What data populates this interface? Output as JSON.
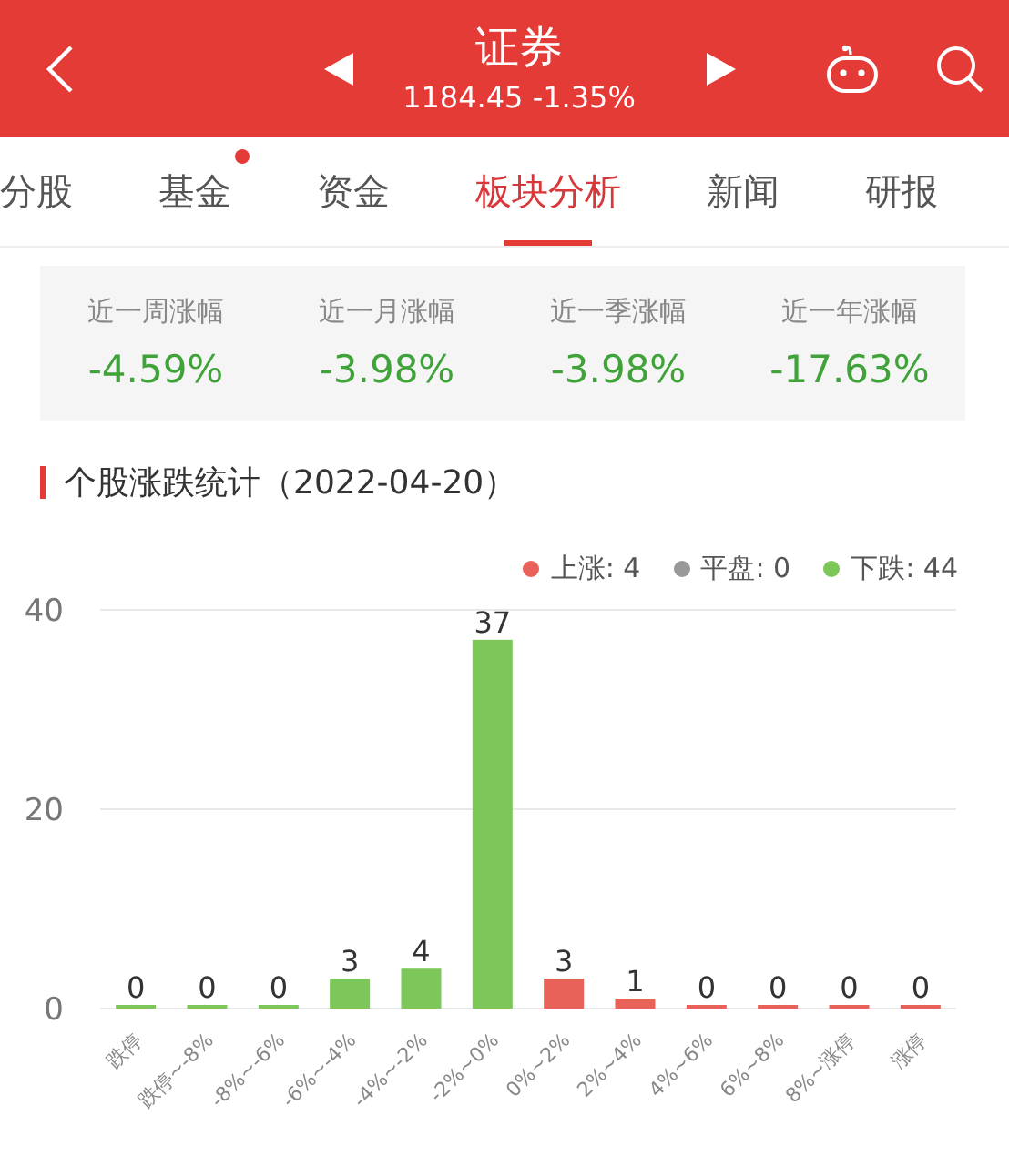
{
  "header": {
    "title": "证券",
    "subtitle": "1184.45 -1.35%"
  },
  "tabs": [
    {
      "label": "分股",
      "selected": false,
      "dot": false
    },
    {
      "label": "基金",
      "selected": false,
      "dot": true
    },
    {
      "label": "资金",
      "selected": false,
      "dot": false
    },
    {
      "label": "板块分析",
      "selected": true,
      "dot": false
    },
    {
      "label": "新闻",
      "selected": false,
      "dot": false
    },
    {
      "label": "研报",
      "selected": false,
      "dot": false
    }
  ],
  "stats": [
    {
      "label": "近一周涨幅",
      "value": "-4.59%"
    },
    {
      "label": "近一月涨幅",
      "value": "-3.98%"
    },
    {
      "label": "近一季涨幅",
      "value": "-3.98%"
    },
    {
      "label": "近一年涨幅",
      "value": "-17.63%"
    }
  ],
  "section_title": "个股涨跌统计（2022-04-20）",
  "legend": [
    {
      "label": "上涨: 4",
      "color": "#e8625a"
    },
    {
      "label": "平盘: 0",
      "color": "#999999"
    },
    {
      "label": "下跌: 44",
      "color": "#7dc75a"
    }
  ],
  "chart_data": {
    "type": "bar",
    "categories": [
      "跌停",
      "跌停~-8%",
      "-8%~-6%",
      "-6%~-4%",
      "-4%~-2%",
      "-2%~0%",
      "0%~2%",
      "2%~4%",
      "4%~6%",
      "6%~8%",
      "8%~涨停",
      "涨停"
    ],
    "values": [
      0,
      0,
      0,
      3,
      4,
      37,
      3,
      1,
      0,
      0,
      0,
      0
    ],
    "colors": [
      "#7dc75a",
      "#7dc75a",
      "#7dc75a",
      "#7dc75a",
      "#7dc75a",
      "#7dc75a",
      "#e8625a",
      "#e8625a",
      "#e8625a",
      "#e8625a",
      "#e8625a",
      "#e8625a"
    ],
    "yticks": [
      0,
      20,
      40
    ],
    "ylim": [
      0,
      40
    ],
    "data_labels": true
  }
}
